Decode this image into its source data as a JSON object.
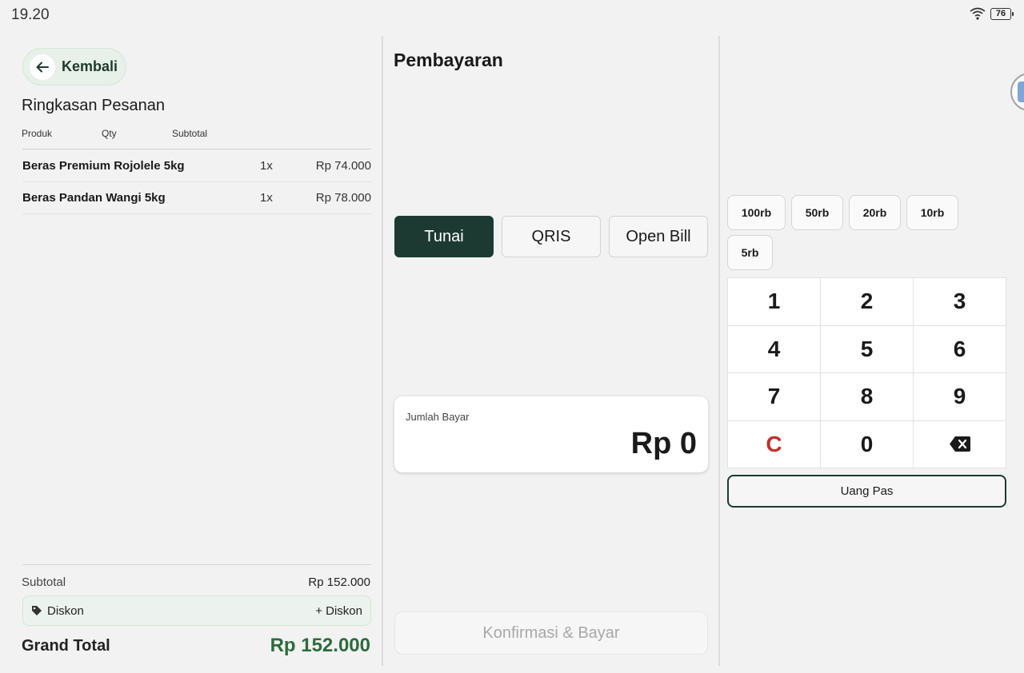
{
  "status": {
    "time": "19.20",
    "battery": "76"
  },
  "left": {
    "back_label": "Kembali",
    "title": "Ringkasan Pesanan",
    "columns": {
      "product": "Produk",
      "qty": "Qty",
      "subtotal": "Subtotal"
    },
    "items": [
      {
        "name": "Beras Premium Rojolele 5kg",
        "qty": "1x",
        "subtotal": "Rp 74.000"
      },
      {
        "name": "Beras Pandan Wangi 5kg",
        "qty": "1x",
        "subtotal": "Rp 78.000"
      }
    ],
    "subtotal_label": "Subtotal",
    "subtotal_value": "Rp 152.000",
    "discount_label": "Diskon",
    "discount_add": "+ Diskon",
    "grand_label": "Grand Total",
    "grand_value": "Rp 152.000"
  },
  "payment": {
    "title": "Pembayaran",
    "methods": [
      {
        "label": "Tunai",
        "active": true
      },
      {
        "label": "QRIS",
        "active": false
      },
      {
        "label": "Open Bill",
        "active": false
      }
    ],
    "amount_label": "Jumlah Bayar",
    "amount_value": "Rp 0",
    "confirm_label": "Konfirmasi & Bayar"
  },
  "keypad": {
    "quick_amounts": [
      "100rb",
      "50rb",
      "20rb",
      "10rb",
      "5rb"
    ],
    "keys": [
      "1",
      "2",
      "3",
      "4",
      "5",
      "6",
      "7",
      "8",
      "9",
      "C",
      "0"
    ],
    "exact_label": "Uang Pas"
  },
  "colors": {
    "primary": "#1d3a32",
    "accent_green": "#2d6b3c",
    "clear_red": "#c0302a",
    "background": "#f2f2f2"
  }
}
